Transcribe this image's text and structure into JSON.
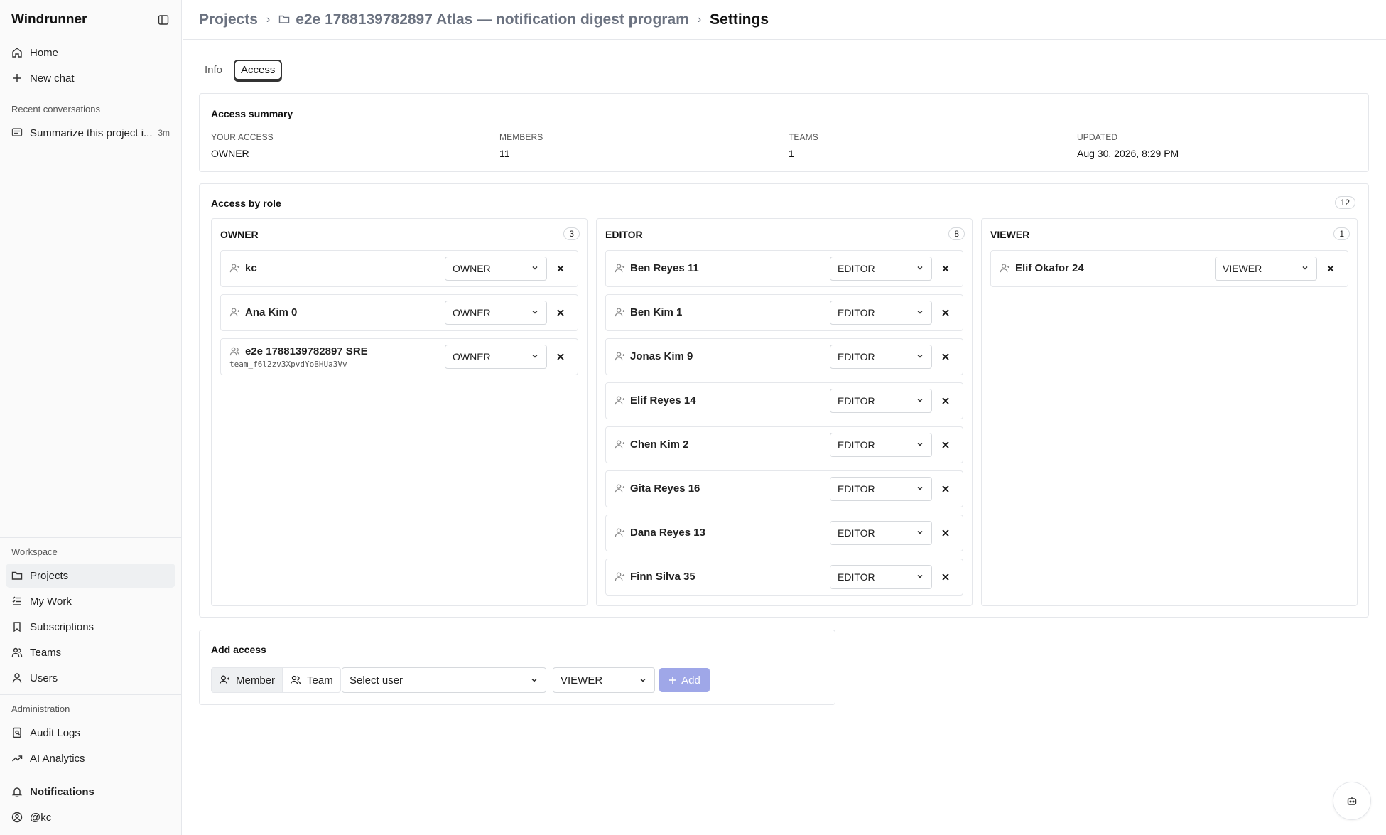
{
  "app": {
    "name": "Windrunner"
  },
  "sidebar": {
    "top_items": [
      {
        "label": "Home",
        "icon": "home-icon"
      },
      {
        "label": "New chat",
        "icon": "plus-icon"
      }
    ],
    "recent_label": "Recent conversations",
    "recent": [
      {
        "title": "Summarize this project i...",
        "time": "3m"
      }
    ],
    "workspace_label": "Workspace",
    "workspace_items": [
      {
        "label": "Projects",
        "icon": "folder-icon",
        "active": true
      },
      {
        "label": "My Work",
        "icon": "list-icon"
      },
      {
        "label": "Subscriptions",
        "icon": "bookmark-icon"
      },
      {
        "label": "Teams",
        "icon": "users-icon"
      },
      {
        "label": "Users",
        "icon": "user-icon"
      }
    ],
    "admin_label": "Administration",
    "admin_items": [
      {
        "label": "Audit Logs",
        "icon": "audit-icon"
      },
      {
        "label": "AI Analytics",
        "icon": "trend-icon"
      }
    ],
    "notifications": "Notifications",
    "user": "@kc"
  },
  "header": {
    "crumb_projects": "Projects",
    "crumb_project": "e2e 1788139782897 Atlas — notification digest program",
    "crumb_current": "Settings"
  },
  "tabs": {
    "info": "Info",
    "access": "Access"
  },
  "summary": {
    "title": "Access summary",
    "stats": [
      {
        "label": "YOUR ACCESS",
        "value": "OWNER"
      },
      {
        "label": "MEMBERS",
        "value": "11"
      },
      {
        "label": "TEAMS",
        "value": "1"
      },
      {
        "label": "UPDATED",
        "value": "Aug 30, 2026, 8:29 PM"
      }
    ]
  },
  "by_role": {
    "title": "Access by role",
    "total": "12",
    "columns": [
      {
        "title": "OWNER",
        "count": "3",
        "rows": [
          {
            "name": "kc",
            "role": "OWNER",
            "type": "user"
          },
          {
            "name": "Ana Kim 0",
            "role": "OWNER",
            "type": "user"
          },
          {
            "name": "e2e 1788139782897 SRE",
            "sub": "team_f6l2zv3XpvdYoBHUa3Vv",
            "role": "OWNER",
            "type": "team"
          }
        ]
      },
      {
        "title": "EDITOR",
        "count": "8",
        "rows": [
          {
            "name": "Ben Reyes 11",
            "role": "EDITOR",
            "type": "user"
          },
          {
            "name": "Ben Kim 1",
            "role": "EDITOR",
            "type": "user"
          },
          {
            "name": "Jonas Kim 9",
            "role": "EDITOR",
            "type": "user"
          },
          {
            "name": "Elif Reyes 14",
            "role": "EDITOR",
            "type": "user"
          },
          {
            "name": "Chen Kim 2",
            "role": "EDITOR",
            "type": "user"
          },
          {
            "name": "Gita Reyes 16",
            "role": "EDITOR",
            "type": "user"
          },
          {
            "name": "Dana Reyes 13",
            "role": "EDITOR",
            "type": "user"
          },
          {
            "name": "Finn Silva 35",
            "role": "EDITOR",
            "type": "user"
          }
        ]
      },
      {
        "title": "VIEWER",
        "count": "1",
        "rows": [
          {
            "name": "Elif Okafor 24",
            "role": "VIEWER",
            "type": "user"
          }
        ]
      }
    ]
  },
  "add_access": {
    "title": "Add access",
    "member": "Member",
    "team": "Team",
    "user_placeholder": "Select user",
    "role": "VIEWER",
    "add": "Add"
  },
  "colors": {
    "accent_disabled": "#9fa7e8",
    "border": "#e5e7eb"
  }
}
